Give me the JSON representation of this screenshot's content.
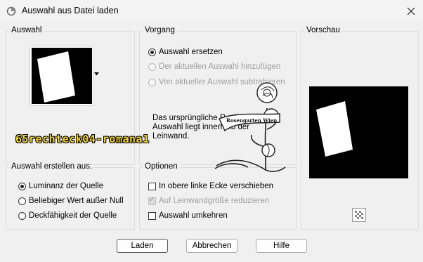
{
  "window": {
    "title": "Auswahl aus Datei laden",
    "close_icon": "close-icon"
  },
  "auswahl_group": {
    "title": "Auswahl",
    "thumbnail_icon": "rotated-rectangle-thumbnail",
    "dropdown_icon": "triangle-down-icon"
  },
  "vorgang_group": {
    "title": "Vorgang",
    "options": [
      {
        "label": "Auswahl ersetzen",
        "selected": true,
        "enabled": true
      },
      {
        "label": "Der aktuellen Auswahl hinzufügen",
        "selected": false,
        "enabled": false
      },
      {
        "label": "Von aktueller Auswahl subtrahieren",
        "selected": false,
        "enabled": false
      }
    ],
    "description": {
      "line1": "Das ursprüngliche Rechteck dieser",
      "line2": "Auswahl liegt innerhalb der",
      "line3": "Leinwand."
    }
  },
  "vorschau_group": {
    "title": "Vorschau",
    "checker_icon": "transparency-checker-icon"
  },
  "erstellen_group": {
    "title": "Auswahl erstellen aus:",
    "options": [
      {
        "label": "Luminanz der Quelle",
        "selected": true
      },
      {
        "label": "Beliebiger Wert außer Null",
        "selected": false
      },
      {
        "label": "Deckfähigkeit der Quelle",
        "selected": false
      }
    ]
  },
  "optionen_group": {
    "title": "Optionen",
    "options": [
      {
        "label": "In obere linke Ecke verschieben",
        "checked": false,
        "enabled": true
      },
      {
        "label": "Auf Leinwandgröße reduzieren",
        "checked": true,
        "enabled": false
      },
      {
        "label": "Auswahl umkehren",
        "checked": false,
        "enabled": true
      }
    ]
  },
  "buttons": {
    "load": "Laden",
    "cancel": "Abbrechen",
    "help": "Hilfe"
  },
  "overlay": {
    "watermark_text": "65rechteck04-romana1",
    "logo_text": "Rosengarten Wien"
  },
  "colors": {
    "watermark": "#f0d040",
    "black": "#000000",
    "white": "#ffffff"
  }
}
